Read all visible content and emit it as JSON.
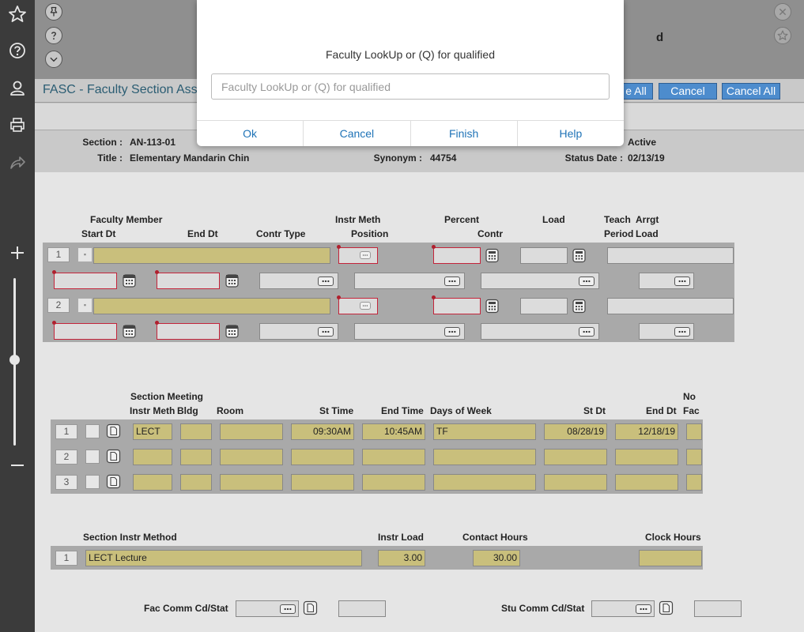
{
  "header": {
    "title_suffix": "d"
  },
  "form": {
    "title": "FASC - Faculty Section Ass",
    "buttons": {
      "save_all": "e All",
      "cancel": "Cancel",
      "cancel_all": "Cancel All"
    }
  },
  "info": {
    "section_label": "Section :",
    "section_value": "AN-113-01",
    "title_label": "Title :",
    "title_value": "Elementary Mandarin Chin",
    "synonym_label": "Synonym :",
    "synonym_value": "44754",
    "status_value": "Active",
    "status_date_label": "Status Date :",
    "status_date_value": "02/13/19"
  },
  "faculty": {
    "headers": {
      "faculty_member": "Faculty Member",
      "start_dt": "Start Dt",
      "end_dt": "End Dt",
      "contr_type": "Contr Type",
      "instr_meth": "Instr Meth",
      "position": "Position",
      "percent": "Percent",
      "contr": "Contr",
      "load": "Load",
      "teach": "Teach",
      "period": "Period",
      "arrgt": "Arrgt",
      "arrgt_load": "Load"
    },
    "rows": [
      {
        "num": "1"
      },
      {
        "num": "2"
      }
    ]
  },
  "meeting": {
    "headers": {
      "section_meeting": "Section Meeting",
      "instr_meth": "Instr Meth",
      "bldg": "Bldg",
      "room": "Room",
      "st_time": "St Time",
      "end_time": "End Time",
      "days_of_week": "Days of Week",
      "st_dt": "St Dt",
      "end_dt": "End Dt",
      "no": "No",
      "fac": "Fac"
    },
    "rows": [
      {
        "num": "1",
        "instr_meth": "LECT",
        "bldg": "",
        "room": "",
        "st_time": "09:30AM",
        "end_time": "10:45AM",
        "days": "TF",
        "st_dt": "08/28/19",
        "end_dt": "12/18/19",
        "no_fac": ""
      },
      {
        "num": "2",
        "instr_meth": "",
        "bldg": "",
        "room": "",
        "st_time": "",
        "end_time": "",
        "days": "",
        "st_dt": "",
        "end_dt": "",
        "no_fac": ""
      },
      {
        "num": "3",
        "instr_meth": "",
        "bldg": "",
        "room": "",
        "st_time": "",
        "end_time": "",
        "days": "",
        "st_dt": "",
        "end_dt": "",
        "no_fac": ""
      }
    ]
  },
  "instr_method": {
    "headers": {
      "section_instr_method": "Section Instr Method",
      "instr_load": "Instr Load",
      "contact_hours": "Contact Hours",
      "clock_hours": "Clock Hours"
    },
    "rows": [
      {
        "num": "1",
        "method": "LECT Lecture",
        "instr_load": "3.00",
        "contact_hours": "30.00",
        "clock_hours": ""
      }
    ]
  },
  "footer": {
    "fac_comm_label": "Fac Comm Cd/Stat",
    "stu_comm_label": "Stu Comm Cd/Stat"
  },
  "modal": {
    "label": "Faculty LookUp or (Q) for qualified",
    "placeholder": "Faculty LookUp or (Q) for qualified",
    "buttons": {
      "ok": "Ok",
      "cancel": "Cancel",
      "finish": "Finish",
      "help": "Help"
    }
  },
  "colors": {
    "accent_button": "#4d8ccd",
    "field_yellow": "#c9bf7c",
    "required_red": "#c4243a",
    "link_blue": "#1f73b7"
  }
}
